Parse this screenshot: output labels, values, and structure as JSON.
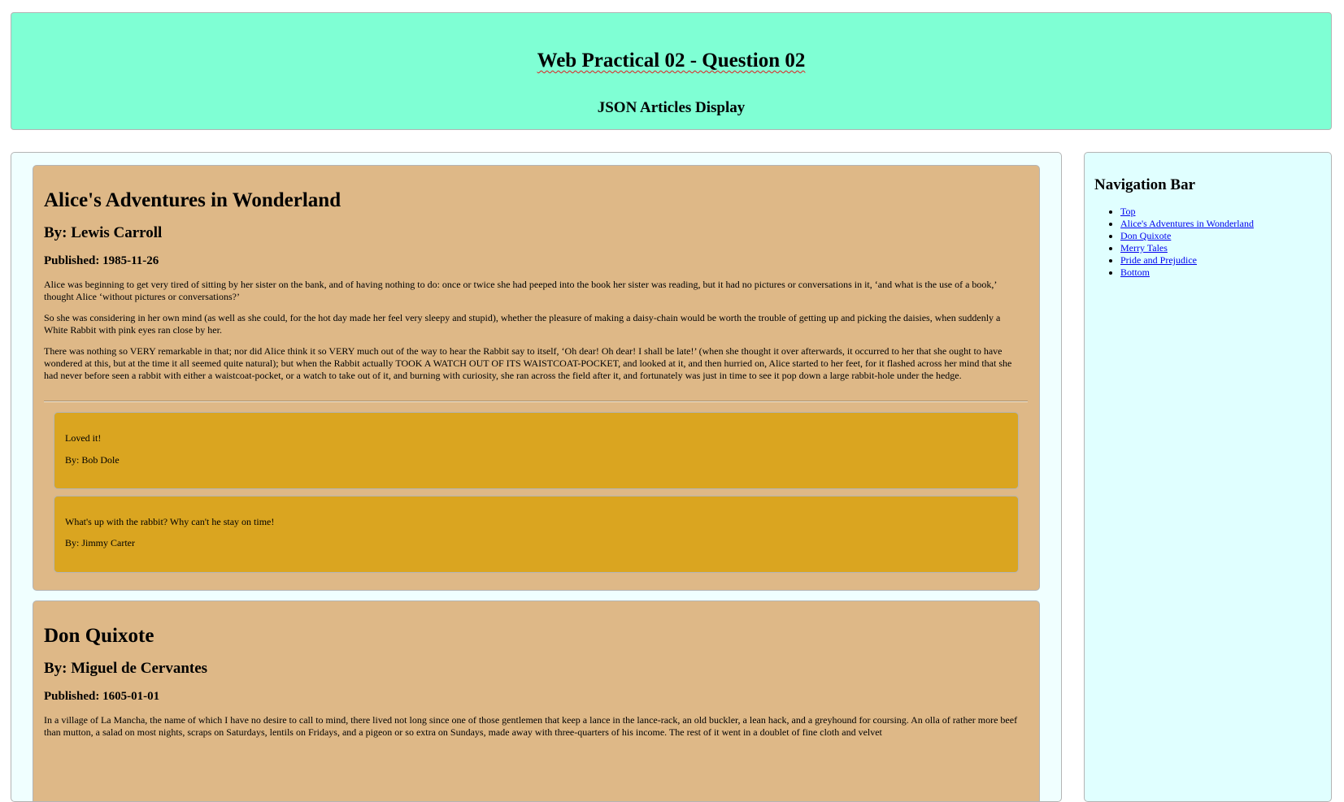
{
  "header": {
    "title": "Web Practical 02 - Question 02",
    "subtitle": "JSON Articles Display"
  },
  "articles": [
    {
      "title": "Alice's Adventures in Wonderland",
      "author": "By: Lewis Carroll",
      "published": "Published: 1985-11-26",
      "paragraphs": [
        "Alice was beginning to get very tired of sitting by her sister on the bank, and of having nothing to do: once or twice she had peeped into the book her sister was reading, but it had no pictures or conversations in it, ‘and what is the use of a book,’ thought Alice ‘without pictures or conversations?’",
        "So she was considering in her own mind (as well as she could, for the hot day made her feel very sleepy and stupid), whether the pleasure of making a daisy-chain would be worth the trouble of getting up and picking the daisies, when suddenly a White Rabbit with pink eyes ran close by her.",
        "There was nothing so VERY remarkable in that; nor did Alice think it so VERY much out of the way to hear the Rabbit say to itself, ‘Oh dear! Oh dear! I shall be late!’ (when she thought it over afterwards, it occurred to her that she ought to have wondered at this, but at the time it all seemed quite natural); but when the Rabbit actually TOOK A WATCH OUT OF ITS WAISTCOAT-POCKET, and looked at it, and then hurried on, Alice started to her feet, for it flashed across her mind that she had never before seen a rabbit with either a waistcoat-pocket, or a watch to take out of it, and burning with curiosity, she ran across the field after it, and fortunately was just in time to see it pop down a large rabbit-hole under the hedge."
      ],
      "comments": [
        {
          "text": "Loved it!",
          "author": "By: Bob Dole"
        },
        {
          "text": "What's up with the rabbit? Why can't he stay on time!",
          "author": "By: Jimmy Carter"
        }
      ]
    },
    {
      "title": "Don Quixote",
      "author": "By: Miguel de Cervantes",
      "published": "Published: 1605-01-01",
      "paragraphs": [
        "In a village of La Mancha, the name of which I have no desire to call to mind, there lived not long since one of those gentlemen that keep a lance in the lance-rack, an old buckler, a lean hack, and a greyhound for coursing. An olla of rather more beef than mutton, a salad on most nights, scraps on Saturdays, lentils on Fridays, and a pigeon or so extra on Sundays, made away with three-quarters of his income. The rest of it went in a doublet of fine cloth and velvet"
      ]
    }
  ],
  "nav": {
    "title": "Navigation Bar",
    "links": [
      "Top",
      "Alice's Adventures in Wonderland",
      "Don Quixote",
      "Merry Tales",
      "Pride and Prejudice",
      "Bottom"
    ]
  }
}
